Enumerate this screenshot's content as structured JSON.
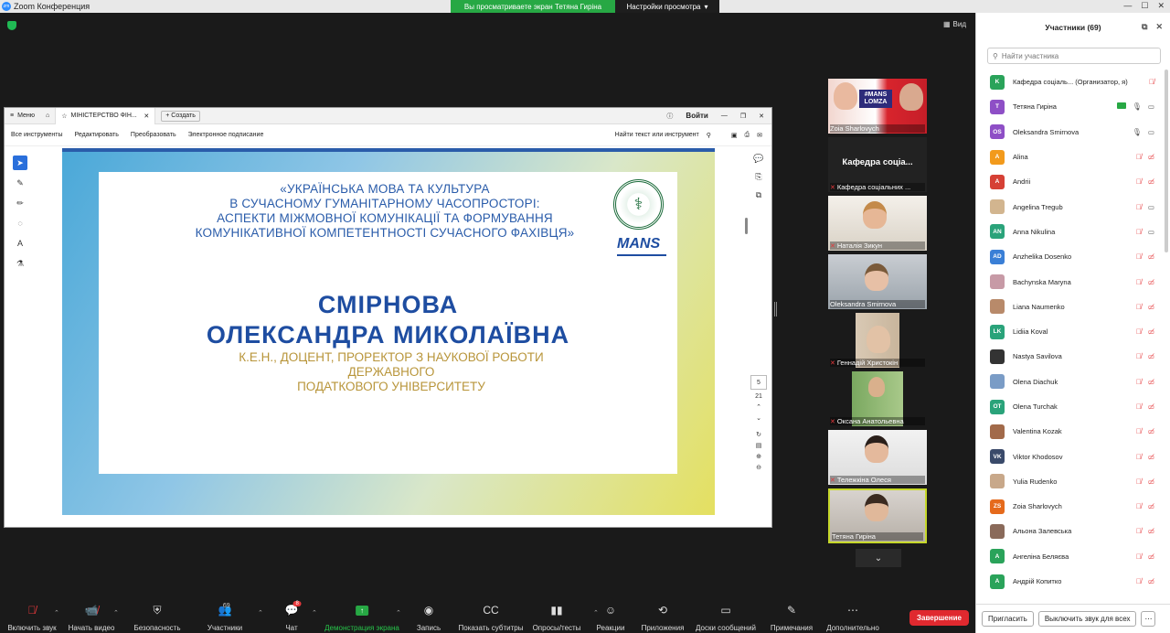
{
  "titlebar": {
    "app_title": "Zoom Конференция",
    "share_banner": "Вы просматриваете экран Тетяна Гиріна",
    "view_settings": "Настройки просмотра"
  },
  "meeting": {
    "view_label": "Вид"
  },
  "pdf": {
    "menu_label": "Меню",
    "tab_title": "МІНІСТЕРСТВО ФІН...",
    "create_label": "Создать",
    "signin_label": "Войти",
    "toolbar": [
      "Все инструменты",
      "Редактировать",
      "Преобразовать",
      "Электронное подписание"
    ],
    "find_label": "Найти текст или инструмент",
    "page_current": "5",
    "page_total": "21"
  },
  "slide": {
    "conference_lines": [
      "«УКРАЇНСЬКА МОВА ТА КУЛЬТУРА",
      "В СУЧАСНОМУ ГУМАНІТАРНОМУ ЧАСОПРОСТОРІ:",
      "АСПЕКТИ МІЖМОВНОЇ КОМУНІКАЦІЇ ТА ФОРМУВАННЯ",
      "КОМУНІКАТИВНОЇ КОМПЕТЕНТНОСТІ СУЧАСНОГО ФАХІВЦЯ»"
    ],
    "logo_text": "MANS",
    "surname": "СМІРНОВА",
    "fullname": "ОЛЕКСАНДРА МИКОЛАЇВНА",
    "position_lines": [
      "К.Е.Н., ДОЦЕНТ, ПРОРЕКТОР З НАУКОВОЇ РОБОТИ ДЕРЖАВНОГО",
      "ПОДАТКОВОГО УНІВЕРСИТЕТУ"
    ]
  },
  "videos": [
    {
      "name": "Zoia Sharlovych",
      "muted": false,
      "type": "video",
      "sign": "#MANS LOMZA"
    },
    {
      "name": "Кафедра соціальних ...",
      "center": "Кафедра  соціа...",
      "muted": true,
      "type": "name"
    },
    {
      "name": "Наталія Зикун",
      "muted": true,
      "type": "video"
    },
    {
      "name": "Oleksandra Smirnova",
      "muted": false,
      "type": "video"
    },
    {
      "name": "Геннадій Христокін",
      "muted": true,
      "type": "video"
    },
    {
      "name": "Оксана Анатольевна",
      "muted": true,
      "type": "video"
    },
    {
      "name": "Тележкіна Олеся",
      "muted": true,
      "type": "video"
    },
    {
      "name": "Тетяна Гиріна",
      "muted": false,
      "type": "video",
      "active": true
    }
  ],
  "participants_panel": {
    "title": "Участники (69)",
    "search_placeholder": "Найти участника",
    "invite_label": "Пригласить",
    "mute_all_label": "Выключить звук для всех",
    "rows": [
      {
        "initials": "K",
        "color": "#2aa35a",
        "name": "Кафедра соціаль... (Организатор, я)",
        "mic": "off",
        "cam": "none"
      },
      {
        "initials": "T",
        "color": "#8e4fc6",
        "name": "Тетяна Гиріна",
        "mic": "on",
        "cam": "on",
        "share": true
      },
      {
        "initials": "OS",
        "color": "#8e4fc6",
        "name": "Oleksandra Smirnova",
        "mic": "on",
        "cam": "on"
      },
      {
        "initials": "A",
        "color": "#f29a1c",
        "name": "Alina",
        "mic": "off",
        "cam": "off"
      },
      {
        "initials": "A",
        "color": "#d64035",
        "name": "Andrii",
        "mic": "off",
        "cam": "off"
      },
      {
        "initials": "",
        "color": "#d2b58f",
        "name": "Angelina Tregub",
        "mic": "off",
        "cam": "on"
      },
      {
        "initials": "AN",
        "color": "#2aa37a",
        "name": "Anna Nikulina",
        "mic": "off",
        "cam": "on"
      },
      {
        "initials": "AD",
        "color": "#3a7fd6",
        "name": "Anzhelika Dosenko",
        "mic": "off",
        "cam": "off"
      },
      {
        "initials": "",
        "color": "#c79aa6",
        "name": "Bachynska Maryna",
        "mic": "off",
        "cam": "off"
      },
      {
        "initials": "",
        "color": "#b88a6a",
        "name": "Liana Naumenko",
        "mic": "off",
        "cam": "off"
      },
      {
        "initials": "LK",
        "color": "#2aa37a",
        "name": "Lidiia Koval",
        "mic": "off",
        "cam": "off"
      },
      {
        "initials": "",
        "color": "#333333",
        "name": "Nastya Savilova",
        "mic": "off",
        "cam": "off"
      },
      {
        "initials": "",
        "color": "#7a9cc6",
        "name": "Olena Diachuk",
        "mic": "off",
        "cam": "off"
      },
      {
        "initials": "OT",
        "color": "#2aa37a",
        "name": "Olena Turchak",
        "mic": "off",
        "cam": "off"
      },
      {
        "initials": "",
        "color": "#a26a4a",
        "name": "Valentina Kozak",
        "mic": "off",
        "cam": "off"
      },
      {
        "initials": "VK",
        "color": "#3a4a6a",
        "name": "Viktor Khodosov",
        "mic": "off",
        "cam": "off"
      },
      {
        "initials": "",
        "color": "#c8a88a",
        "name": "Yulia Rudenko",
        "mic": "off",
        "cam": "off"
      },
      {
        "initials": "ZS",
        "color": "#e56a1c",
        "name": "Zoia Sharlovych",
        "mic": "off",
        "cam": "off"
      },
      {
        "initials": "",
        "color": "#8a6a5a",
        "name": "Альона Залевська",
        "mic": "off",
        "cam": "off"
      },
      {
        "initials": "A",
        "color": "#2aa35a",
        "name": "Ангеліна Беляєва",
        "mic": "off",
        "cam": "off"
      },
      {
        "initials": "A",
        "color": "#2aa35a",
        "name": "Андрій Копитко",
        "mic": "off",
        "cam": "off"
      }
    ]
  },
  "toolbar": {
    "items": [
      {
        "label": "Включить звук",
        "icon": "mic-off-icon"
      },
      {
        "label": "Начать видео",
        "icon": "video-off-icon"
      },
      {
        "label": "Безопасность",
        "icon": "shield-icon"
      },
      {
        "label": "Участники",
        "icon": "participants-icon",
        "count": "69"
      },
      {
        "label": "Чат",
        "icon": "chat-icon",
        "badge": "8"
      },
      {
        "label": "Демонстрация экрана",
        "icon": "share-screen-icon"
      },
      {
        "label": "Запись",
        "icon": "record-icon"
      },
      {
        "label": "Показать субтитры",
        "icon": "captions-icon"
      },
      {
        "label": "Опросы/тесты",
        "icon": "polls-icon"
      },
      {
        "label": "Реакции",
        "icon": "reactions-icon"
      },
      {
        "label": "Приложения",
        "icon": "apps-icon"
      },
      {
        "label": "Доски сообщений",
        "icon": "whiteboard-icon"
      },
      {
        "label": "Примечания",
        "icon": "notes-icon"
      },
      {
        "label": "Дополнительно",
        "icon": "more-icon"
      }
    ],
    "end_label": "Завершение"
  }
}
